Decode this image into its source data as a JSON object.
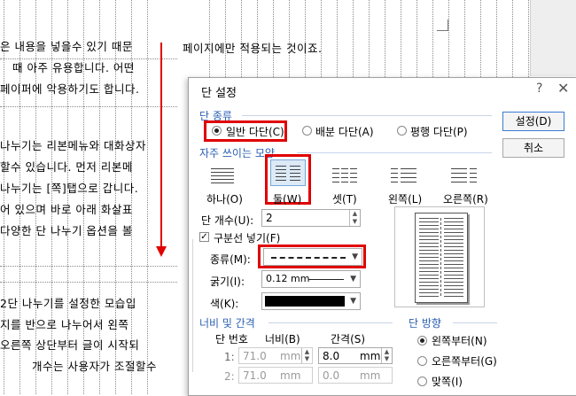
{
  "document": {
    "left_lines": [
      "은 내용을 넣을수 있기 때문",
      "때 아주 유용합니다. 어떤",
      "페이퍼에 악용하기도 합니다.",
      "",
      "",
      "나누기는 리본메뉴와 대화상자",
      "할수 있습니다. 먼저 리본메",
      "나누기는 [쪽]탭으로 갑니다.",
      "어 있으며 바로 아래 화살표",
      "다양한 단 나누기 옵션을 볼",
      "",
      "",
      "",
      "",
      "2단 나누기를 설정한 모습입",
      "지를 반으로 나누어서 왼쪽",
      "오른쪽 상단부터 글이 시작되",
      "개수는 사용자가 조절할수"
    ],
    "right_line": "페이지에만 적용되는 것이죠."
  },
  "dialog": {
    "title": "단 설정",
    "help_icon": "?",
    "close_icon": "✕",
    "column_type": {
      "section": "단 종류",
      "options": [
        "일반 다단(C)",
        "배분 다단(A)",
        "평행 다단(P)"
      ],
      "selected": "일반 다단(C)"
    },
    "presets": {
      "section": "자주 쓰이는 모양",
      "items": [
        "하나(O)",
        "둘(W)",
        "셋(T)",
        "왼쪽(L)",
        "오른쪽(R)"
      ],
      "selected": "둘(W)"
    },
    "column_count": {
      "label": "단 개수(U):",
      "value": "2"
    },
    "separator": {
      "checkbox_label": "구분선 넣기(F)",
      "checked": true,
      "type_label": "종류(M):",
      "width_label": "굵기(I):",
      "width_value": "0.12 mm",
      "color_label": "색(K):",
      "color_value": "#000000"
    },
    "width_spacing": {
      "section": "너비 및 간격",
      "headers": [
        "단 번호",
        "너비(B)",
        "간격(S)"
      ],
      "rows": [
        {
          "no": "1:",
          "width": "71.0",
          "width_unit": "mm",
          "gap": "8.0",
          "gap_unit": "mm"
        },
        {
          "no": "2:",
          "width": "71.0",
          "width_unit": "mm",
          "gap": "0.0",
          "gap_unit": "mm"
        }
      ]
    },
    "direction": {
      "section": "단 방향",
      "options": [
        "왼쪽부터(N)",
        "오른쪽부터(G)",
        "맞쪽(I)"
      ],
      "selected": "왼쪽부터(N)"
    },
    "buttons": {
      "ok": "설정(D)",
      "cancel": "취소"
    }
  }
}
